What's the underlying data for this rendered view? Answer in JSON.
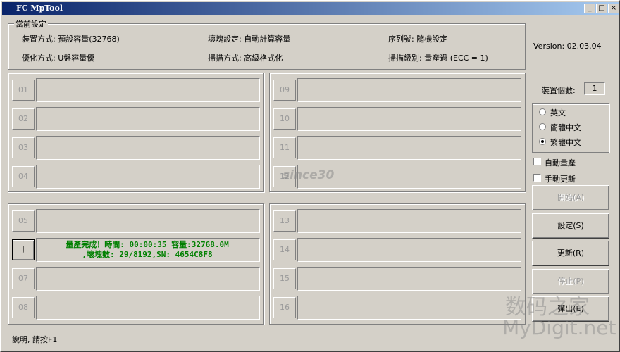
{
  "window": {
    "title": "FC MpTool"
  },
  "settings": {
    "group_title": "當前設定",
    "device_mode": "裝置方式: 預設容量(32768)",
    "bad_block": "壞塊設定: 自動計算容量",
    "serial": "序列號: 隨機設定",
    "optimize": "優化方式: U盤容量優",
    "scan_mode": "掃描方式: 高級格式化",
    "scan_level": "掃描級別: 量產過 (ECC = 1)"
  },
  "version": "Version: 02.03.04",
  "device_count": {
    "label": "裝置個數:",
    "value": "1"
  },
  "language": {
    "options": [
      "英文",
      "簡體中文",
      "繁體中文"
    ],
    "selected": "繁體中文"
  },
  "checkboxes": {
    "auto_produce": "自動量產",
    "manual_update": "手動更新"
  },
  "buttons": {
    "start": "開始(A)",
    "settings": "設定(S)",
    "update": "更新(R)",
    "stop": "停止(P)",
    "exit": "彈出(E)"
  },
  "slots": [
    {
      "label": "01",
      "message": ""
    },
    {
      "label": "02",
      "message": ""
    },
    {
      "label": "03",
      "message": ""
    },
    {
      "label": "04",
      "message": ""
    },
    {
      "label": "05",
      "message": ""
    },
    {
      "label": "J",
      "message_line1": "量產完成！時間: 00:00:35 容量:32768.0M",
      "message_line2": ",壞塊數: 29/8192,SN: 4654C8F8"
    },
    {
      "label": "07",
      "message": ""
    },
    {
      "label": "08",
      "message": ""
    },
    {
      "label": "09",
      "message": ""
    },
    {
      "label": "10",
      "message": ""
    },
    {
      "label": "11",
      "message": ""
    },
    {
      "label": "12",
      "message": ""
    },
    {
      "label": "13",
      "message": ""
    },
    {
      "label": "14",
      "message": ""
    },
    {
      "label": "15",
      "message": ""
    },
    {
      "label": "16",
      "message": ""
    }
  ],
  "status_bar": "說明, 請按F1",
  "watermarks": {
    "since": "since30",
    "digit_cn": "数码之家",
    "digit_en": "MyDigit.net"
  }
}
